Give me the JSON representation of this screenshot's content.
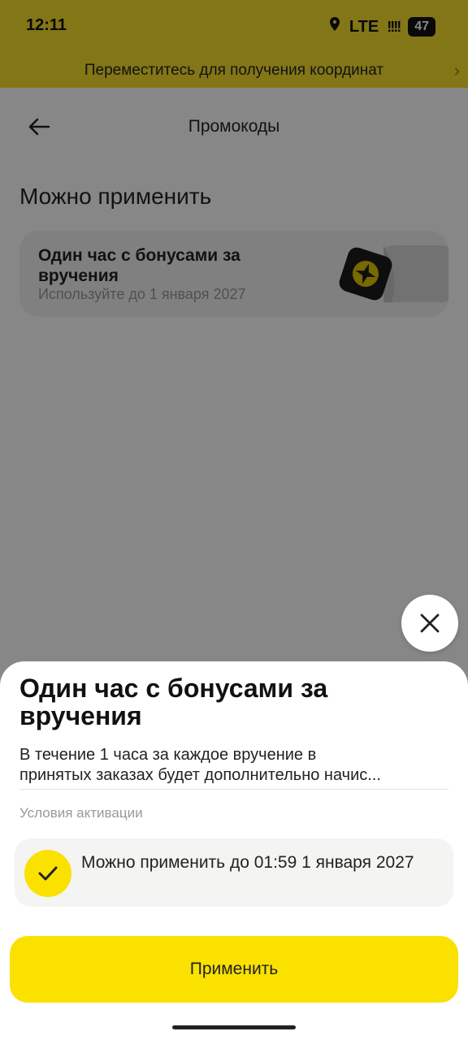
{
  "status_bar": {
    "time": "12:11",
    "network": "LTE",
    "signal": "!!!!",
    "battery": "47",
    "icons": [
      "location-icon",
      "signal-icon",
      "battery-icon"
    ]
  },
  "banner": {
    "text": "Переместитесь для получения координат"
  },
  "header": {
    "title": "Промокоды"
  },
  "section": {
    "title": "Можно применить"
  },
  "promo_card": {
    "title": "Один час с бонусами за вручения",
    "subtitle": "Используйте до 1 января 2027"
  },
  "sheet": {
    "title": "Один час с бонусами за вручения",
    "description_line1": "В течение 1 часа за каждое вручение в",
    "description_line2": "принятых заказах будет дополнительно начис...",
    "conditions_label": "Условия активации",
    "condition_text": "Можно применить до 01:59 1 января 2027",
    "apply_label": "Применить"
  },
  "colors": {
    "accent": "#fae100",
    "status_bar_bg": "#f8df2b",
    "overlay": "rgba(0,0,0,0.47)"
  }
}
